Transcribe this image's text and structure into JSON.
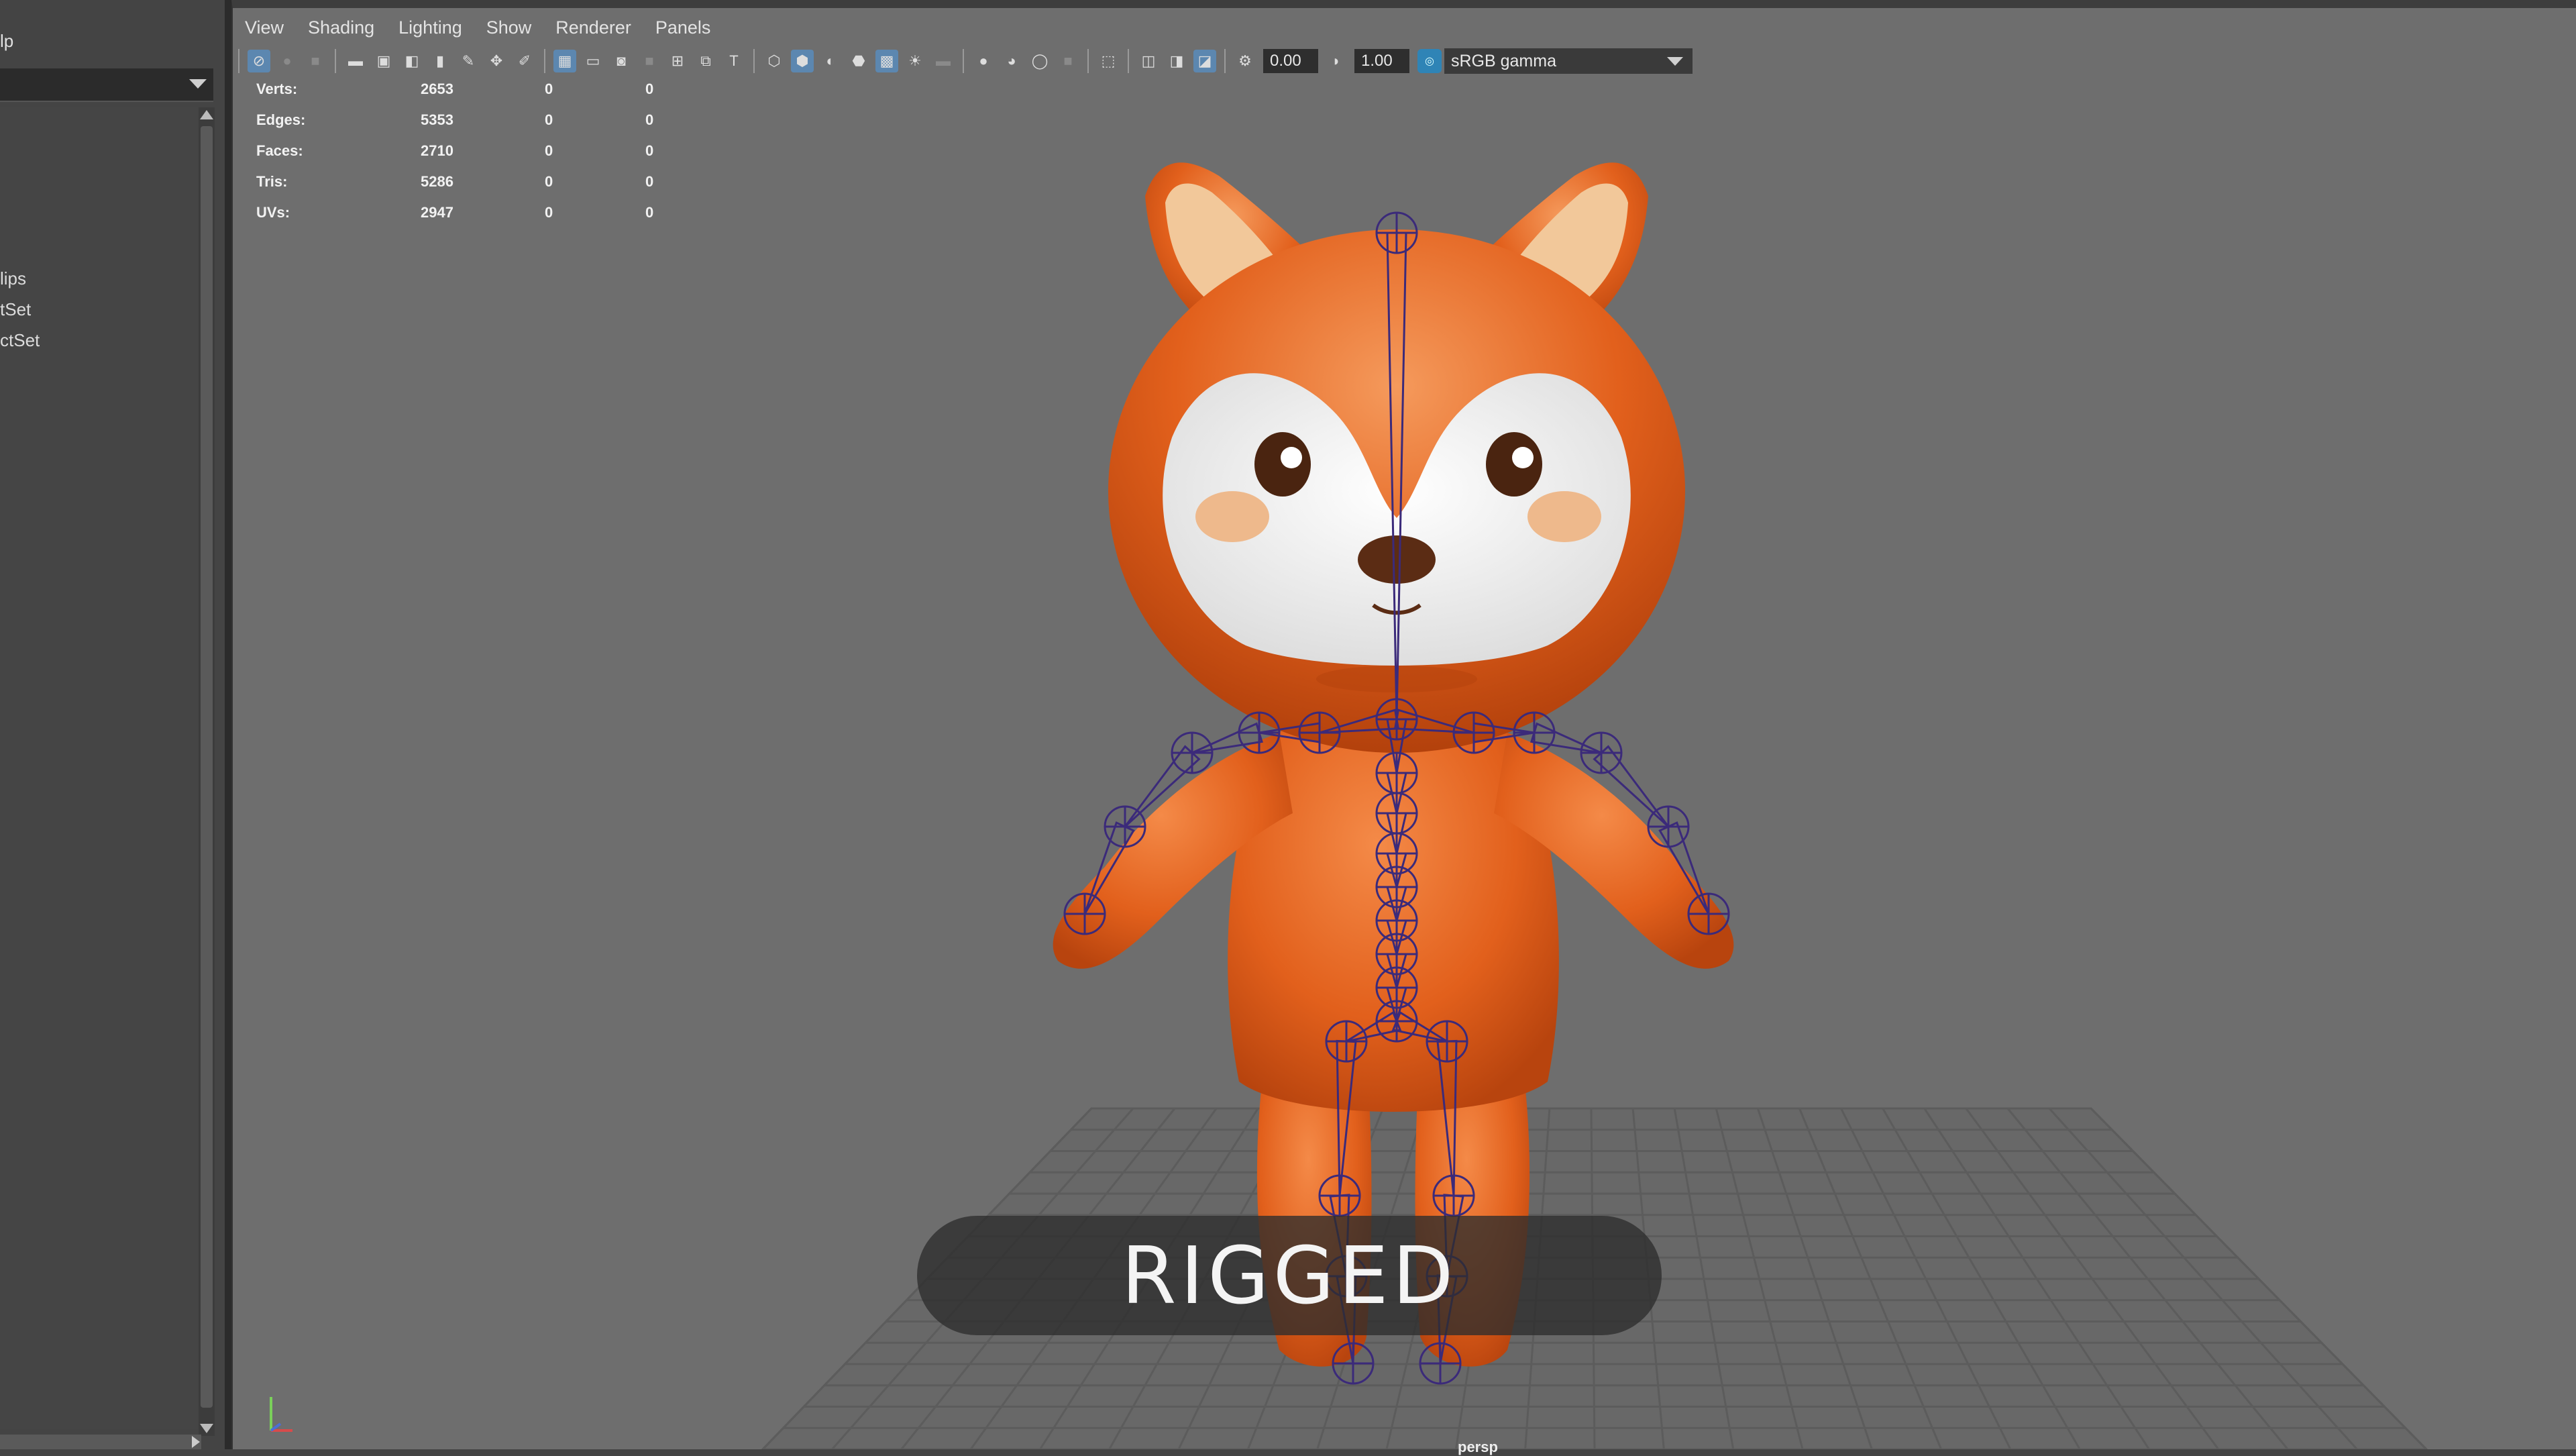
{
  "outliner": {
    "menu_fragment": "lp",
    "items": [
      "lips",
      "tSet",
      "ctSet"
    ]
  },
  "viewport": {
    "menu": [
      "View",
      "Shading",
      "Lighting",
      "Show",
      "Renderer",
      "Panels"
    ],
    "exposure": "0.00",
    "gamma": "1.00",
    "color_space": "sRGB gamma",
    "camera": "persp"
  },
  "hud": {
    "rows": [
      {
        "label": "Verts:",
        "v1": "2653",
        "v2": "0",
        "v3": "0"
      },
      {
        "label": "Edges:",
        "v1": "5353",
        "v2": "0",
        "v3": "0"
      },
      {
        "label": "Faces:",
        "v1": "2710",
        "v2": "0",
        "v3": "0"
      },
      {
        "label": "Tris:",
        "v1": "5286",
        "v2": "0",
        "v3": "0"
      },
      {
        "label": "UVs:",
        "v1": "2947",
        "v2": "0",
        "v3": "0"
      }
    ]
  },
  "overlay": {
    "caption": "RIGGED"
  },
  "colors": {
    "fur": "#e8641e",
    "face": "#f5f5f5",
    "ear_inner": "#f2c89a",
    "joint": "#3b2a7a",
    "grid": "#5a5a5a"
  }
}
